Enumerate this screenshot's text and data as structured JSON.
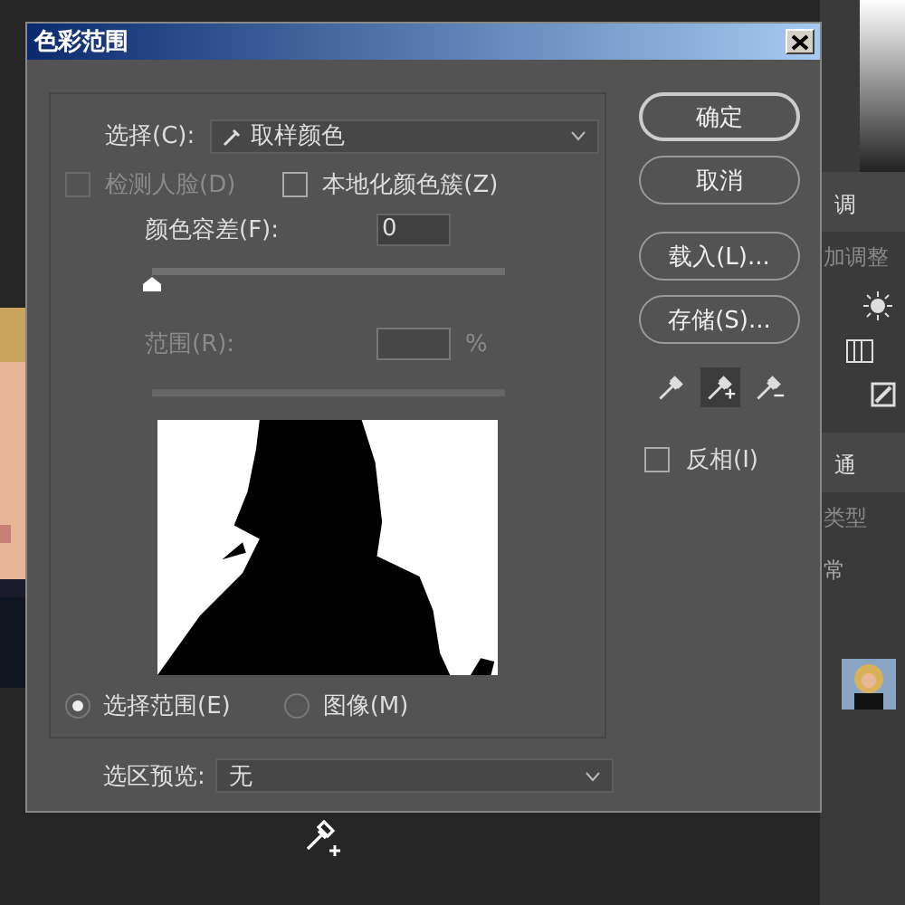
{
  "dialog": {
    "title": "色彩范围",
    "select": {
      "label": "选择(C):",
      "value": "取样颜色"
    },
    "detect_faces": {
      "label": "检测人脸(D)",
      "checked": false,
      "disabled": true
    },
    "localized": {
      "label": "本地化颜色簇(Z)",
      "checked": false,
      "disabled": false
    },
    "fuzziness": {
      "label": "颜色容差(F):",
      "value": "0",
      "level": 0
    },
    "range": {
      "label": "范围(R):",
      "unit": "%",
      "disabled": true
    },
    "preview_modes": [
      {
        "label": "选择范围(E)",
        "selected": true
      },
      {
        "label": "图像(M)",
        "selected": false
      }
    ],
    "buttons": [
      {
        "label": "确定",
        "default": true
      },
      {
        "label": "取消",
        "default": false
      },
      {
        "label": "载入(L)...",
        "default": false
      },
      {
        "label": "存储(S)...",
        "default": false
      }
    ],
    "eyedroppers": [
      {
        "kind": "sample",
        "selected": false
      },
      {
        "kind": "add",
        "selected": true
      },
      {
        "kind": "subtract",
        "selected": false
      }
    ],
    "invert": {
      "label": "反相(I)",
      "checked": false
    },
    "selection_preview": {
      "label": "选区预览:",
      "value": "无"
    }
  },
  "side_panel": {
    "tab": "调",
    "caption": "加调整",
    "tab_2": "通",
    "filter": "类型",
    "blend": "常"
  }
}
